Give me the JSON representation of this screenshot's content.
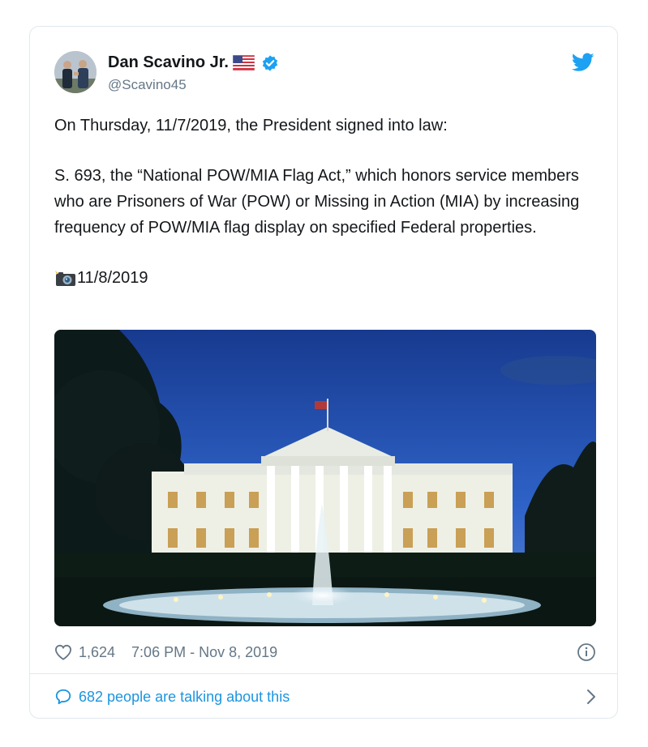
{
  "tweet": {
    "author_name": "Dan Scavino Jr.",
    "handle": "@Scavino45",
    "icons": {
      "flag": "us-flag-emoji",
      "verified": "verified-badge-icon",
      "platform": "twitter-bird-icon",
      "camera": "camera-with-flash-emoji"
    },
    "paragraph_1": "On Thursday, 11/7/2019, the President signed into law:",
    "paragraph_2": "S. 693, the “National POW/MIA Flag Act,” which honors service members who are Prisoners of War (POW) or Missing in Action (MIA) by increasing frequency of POW/MIA flag display on specified Federal properties.",
    "photo_date": "11/8/2019",
    "likes": "1,624",
    "timestamp": "7:06 PM - Nov 8, 2019",
    "talking": "682 people are talking about this"
  },
  "colors": {
    "link_blue": "#1b95e0",
    "verified_blue": "#1da1f2",
    "meta_gray": "#657786",
    "border": "#e1e8ed"
  }
}
